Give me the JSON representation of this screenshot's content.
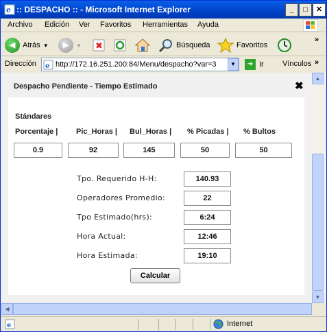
{
  "window": {
    "title": ":: DESPACHO :: - Microsoft Internet Explorer"
  },
  "menu": [
    "Archivo",
    "Edición",
    "Ver",
    "Favoritos",
    "Herramientas",
    "Ayuda"
  ],
  "toolbar": {
    "back": "Atrás",
    "search": "Búsqueda",
    "favorites": "Favoritos"
  },
  "address": {
    "label": "Dirección",
    "url": "http://172.16.251.200:84/Menu/despacho?var=3",
    "go": "Ir",
    "links": "Vínculos"
  },
  "dialog": {
    "title": "Despacho Pendiente - Tiempo Estimado",
    "close": "✖",
    "section": "Stándares",
    "headers": [
      "Porcentaje |",
      "Pic_Horas |",
      "Bul_Horas |",
      "% Picadas |",
      "% Bultos"
    ],
    "values": [
      "0.9",
      "92",
      "145",
      "50",
      "50"
    ],
    "results": [
      {
        "label": "Tpo. Requerido H-H:",
        "value": "140.93"
      },
      {
        "label": "Operadores Promedio:",
        "value": "22"
      },
      {
        "label": "Tpo Estimado(hrs):",
        "value": "6:24"
      },
      {
        "label": "Hora Actual:",
        "value": "12:46"
      },
      {
        "label": "Hora Estimada:",
        "value": "19:10"
      }
    ],
    "button": "Calcular"
  },
  "status": {
    "zone": "Internet"
  }
}
